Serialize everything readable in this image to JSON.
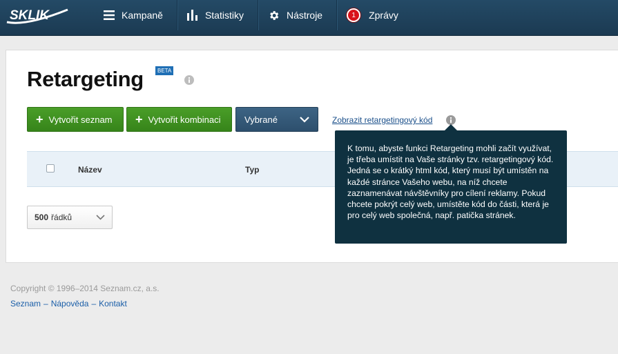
{
  "brand": {
    "logo_text": "SKLIK"
  },
  "nav": {
    "items": [
      {
        "label": "Kampaně",
        "icon": "hamburger-icon"
      },
      {
        "label": "Statistiky",
        "icon": "bar-chart-icon"
      },
      {
        "label": "Nástroje",
        "icon": "gear-icon"
      },
      {
        "label": "Zprávy",
        "icon": "message-badge",
        "badge": "1"
      }
    ]
  },
  "page": {
    "title": "Retargeting",
    "beta_badge": "BETA"
  },
  "toolbar": {
    "create_list": "Vytvořit seznam",
    "create_combination": "Vytvořit kombinaci",
    "selected": "Vybrané",
    "show_code_link": "Zobrazit retargetingový kód"
  },
  "tooltip": {
    "text": "K tomu, abyste funkci Retargeting mohli začít využívat, je třeba umístit na Vaše stránky tzv. retargetingový kód. Jedná se o krátký html kód, který musí být umístěn na každé stránce Vašeho webu, na níž chcete zaznamenávat návštěvníky pro cílení reklamy. Pokud chcete pokrýt celý web, umístěte kód do části, která je pro celý web společná, např. patička stránek."
  },
  "table": {
    "columns": [
      "Název",
      "Typ"
    ]
  },
  "pagination": {
    "rows_value": "500",
    "rows_unit": "řádků"
  },
  "footer": {
    "copyright": "Copyright © 1996–2014 Seznam.cz, a.s.",
    "links": [
      "Seznam",
      "Nápověda",
      "Kontakt"
    ],
    "separator": "–"
  },
  "colors": {
    "topbar": "#1f4460",
    "green_button": "#3f9122",
    "dark_button": "#345a7a",
    "tooltip_bg": "#0f3140",
    "badge_red": "#d9121a",
    "link": "#1a4f8a"
  }
}
